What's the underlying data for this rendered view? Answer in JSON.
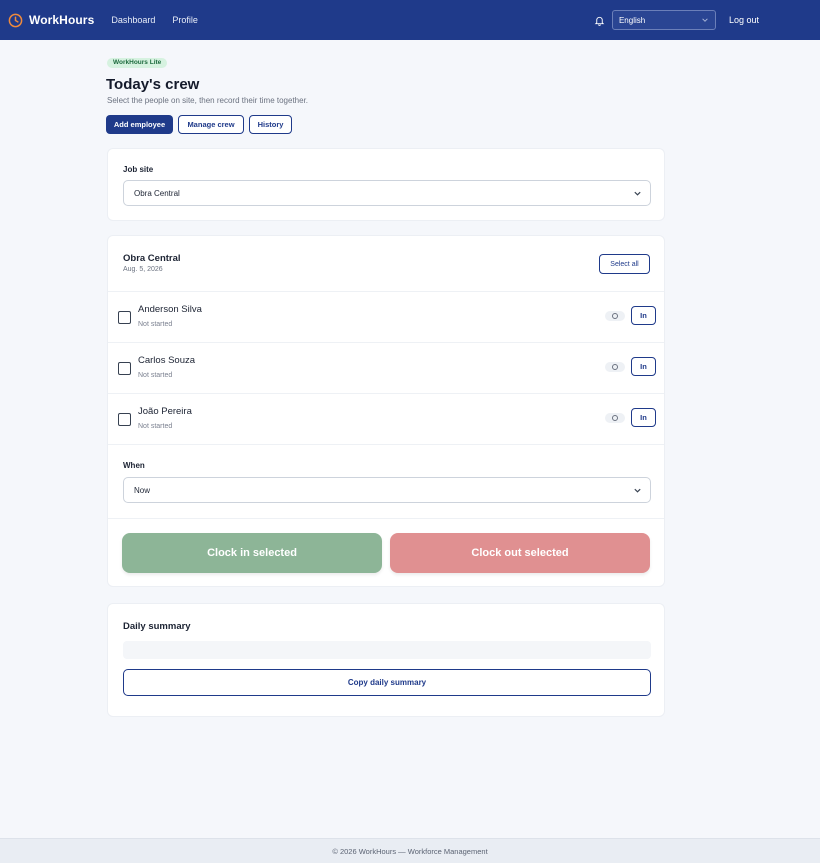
{
  "navbar": {
    "brand": "WorkHours",
    "brand_icon": "clock-icon",
    "links": [
      "Dashboard",
      "Profile"
    ],
    "language": "English",
    "logout": "Log out",
    "colors": {
      "bar": "#1f3a8a",
      "brand_icon": "#f08a3c"
    }
  },
  "header": {
    "badge": "WorkHours Lite",
    "title": "Today's crew",
    "subtitle": "Select the people on site, then record their time together.",
    "buttons": {
      "add": "Add employee",
      "manage": "Manage crew",
      "history": "History"
    }
  },
  "site": {
    "label": "Job site",
    "selected": "Obra Central"
  },
  "crew": {
    "site_name": "Obra Central",
    "date": "Aug. 5, 2026",
    "select_all": "Select all",
    "employees": [
      {
        "name": "Anderson Silva",
        "status": "Not started",
        "action": "In"
      },
      {
        "name": "Carlos Souza",
        "status": "Not started",
        "action": "In"
      },
      {
        "name": "João Pereira",
        "status": "Not started",
        "action": "In"
      }
    ],
    "when_label": "When",
    "when_value": "Now",
    "clock_in": "Clock in selected",
    "clock_out": "Clock out selected"
  },
  "summary": {
    "title": "Daily summary",
    "copy": "Copy daily summary"
  },
  "footer": "© 2026 WorkHours — Workforce Management"
}
